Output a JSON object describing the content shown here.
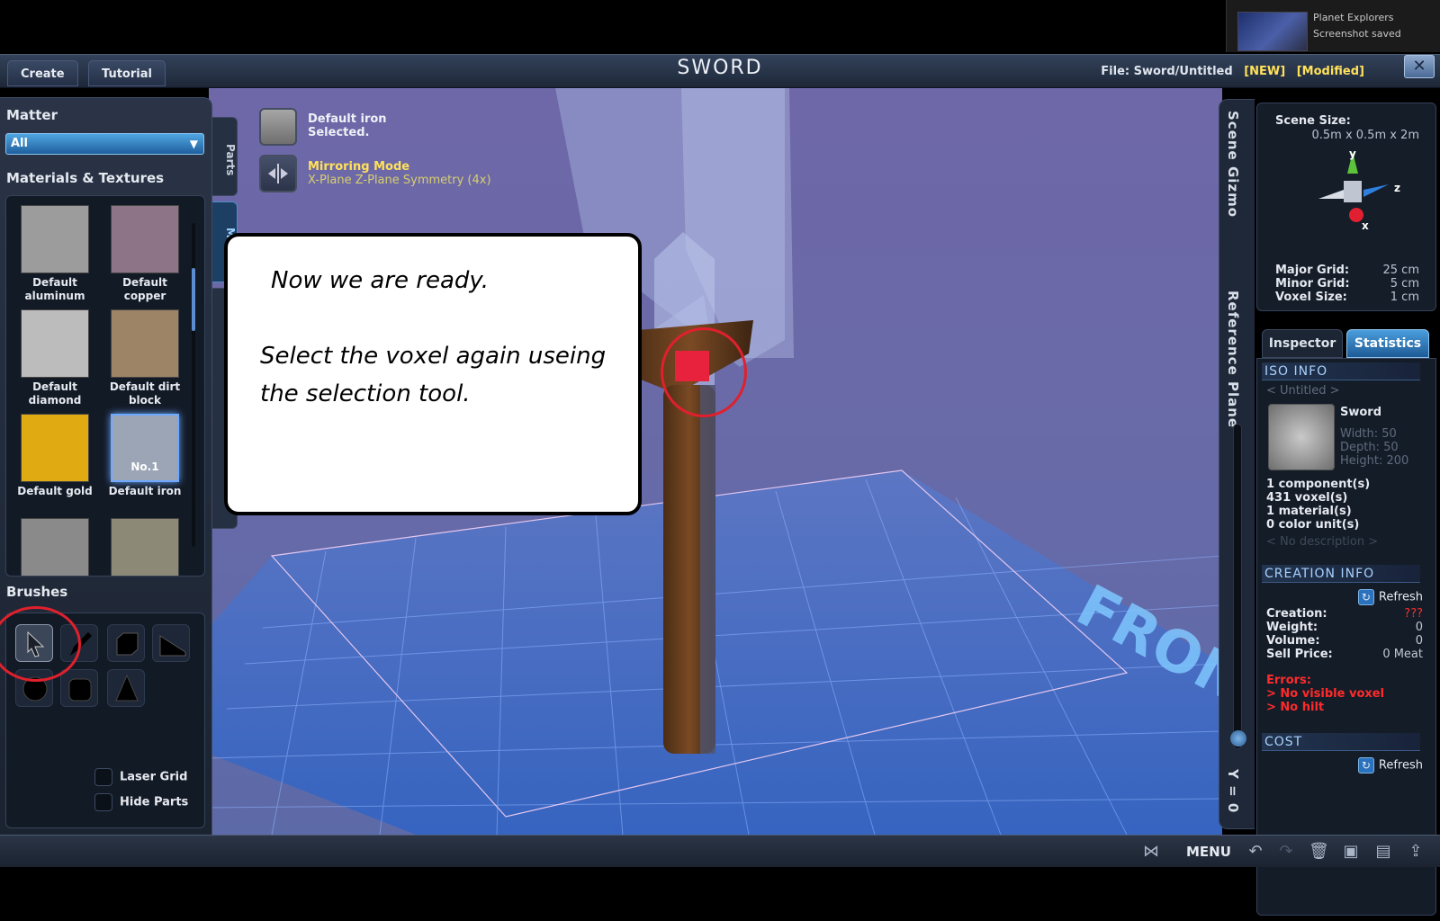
{
  "notification": {
    "app": "Planet Explorers",
    "message": "Screenshot saved"
  },
  "titlebar": {
    "tabs": [
      "Create",
      "Tutorial"
    ],
    "title": "SWORD",
    "file_label": "File:",
    "file_name": "Sword/Untitled",
    "flag_new": "[NEW]",
    "flag_modified": "[Modified]",
    "close_icon": "close-icon"
  },
  "left_panel": {
    "matter_heading": "Matter",
    "matter_value": "All",
    "materials_heading": "Materials & Textures",
    "materials": [
      {
        "label": "Default aluminum",
        "color": "#9c9c9c"
      },
      {
        "label": "Default copper",
        "color": "#8e7487"
      },
      {
        "label": "Default diamond",
        "color": "#bcbcbc"
      },
      {
        "label": "Default dirt block",
        "color": "#9e8466"
      },
      {
        "label": "Default gold",
        "color": "#e0aa12"
      },
      {
        "label": "Default iron",
        "color": "#9ba5b6",
        "badge": "No.1",
        "selected": true
      },
      {
        "label": "",
        "color": "#8a8a8a"
      },
      {
        "label": "",
        "color": "#8c8a76"
      }
    ],
    "brushes_heading": "Brushes",
    "brushes": [
      "select-arrow-icon",
      "pencil-icon",
      "cube-icon",
      "wedge-icon",
      "sphere-icon",
      "cylinder-icon",
      "cone-icon"
    ],
    "checkboxes": [
      "Laser Grid",
      "Hide Parts"
    ]
  },
  "side_tabs": [
    "Parts",
    "Mat..."
  ],
  "info": {
    "selected_line1": "Default iron",
    "selected_line2": "Selected.",
    "mirror_title": "Mirroring Mode",
    "mirror_desc": "X-Plane Z-Plane Symmetry (4x)"
  },
  "callout": {
    "line1": "Now we are ready.",
    "line2": "Select the voxel again useing the selection tool."
  },
  "right_panel": {
    "tab_scene_gizmo": "Scene Gizmo",
    "tab_reference_plane": "Reference Plane",
    "y_label": "Y = 0",
    "scene_size_label": "Scene Size:",
    "scene_size_value": "0.5m x 0.5m x 2m",
    "axes": [
      "y",
      "z",
      "x"
    ],
    "major_grid_label": "Major Grid:",
    "major_grid_value": "25 cm",
    "minor_grid_label": "Minor Grid:",
    "minor_grid_value": "5 cm",
    "voxel_size_label": "Voxel Size:",
    "voxel_size_value": "1 cm",
    "tabs": [
      "Inspector",
      "Statistics"
    ],
    "iso_info_heading": "ISO INFO",
    "iso_name_placeholder": "< Untitled >",
    "iso_title": "Sword",
    "width": "Width: 50",
    "depth": "Depth: 50",
    "height": "Height: 200",
    "components": "1 component(s)",
    "voxels": "431 voxel(s)",
    "materials": "1 material(s)",
    "color_units": "0 color unit(s)",
    "description_placeholder": "< No description >",
    "creation_heading": "CREATION INFO",
    "refresh": "Refresh",
    "creation_label": "Creation:",
    "creation_value": "???",
    "weight_label": "Weight:",
    "weight_value": "0",
    "volume_label": "Volume:",
    "volume_value": "0",
    "sell_label": "Sell Price:",
    "sell_value": "0 Meat",
    "errors_label": "Errors:",
    "error1": "> No visible voxel",
    "error2": "> No hilt",
    "cost_heading": "COST"
  },
  "viewport": {
    "front_label": "FRONT"
  },
  "bottombar": {
    "menu": "MENU"
  }
}
